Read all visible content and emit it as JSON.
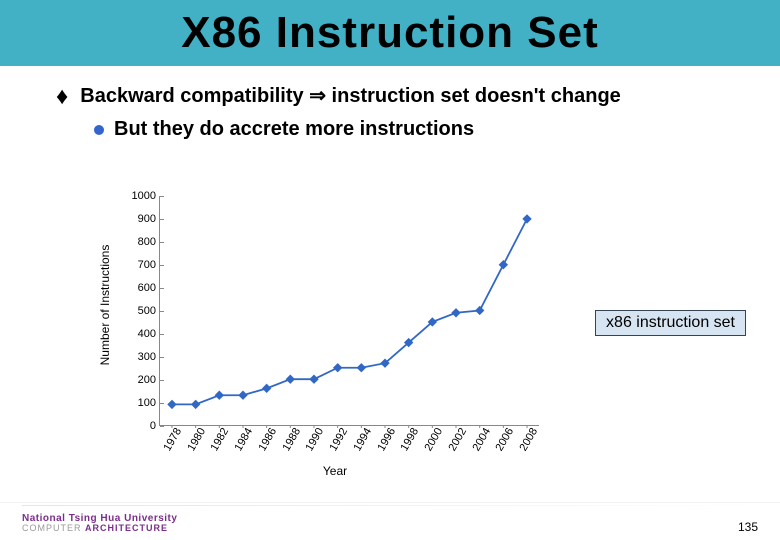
{
  "title": "X86 Instruction Set",
  "bullets": {
    "l1_a": "Backward compatibility ",
    "l1_implies": "⇒",
    "l1_b": " instruction set doesn't change",
    "l2": "But they do accrete more instructions"
  },
  "callout": "x86 instruction set",
  "footer": {
    "university": "National Tsing Hua University",
    "dept_a": "COMPUTER ",
    "dept_b": "ARCHITECTURE",
    "page": "135"
  },
  "chart_data": {
    "type": "line",
    "title": "",
    "xlabel": "Year",
    "ylabel": "Number of Instructions",
    "ylim": [
      0,
      1000
    ],
    "yticks": [
      0,
      100,
      200,
      300,
      400,
      500,
      600,
      700,
      800,
      900,
      1000
    ],
    "categories": [
      "1978",
      "1980",
      "1982",
      "1984",
      "1986",
      "1988",
      "1990",
      "1992",
      "1994",
      "1996",
      "1998",
      "2000",
      "2002",
      "2004",
      "2006",
      "2008"
    ],
    "values": [
      90,
      90,
      130,
      130,
      160,
      200,
      200,
      250,
      250,
      270,
      360,
      450,
      490,
      500,
      700,
      900
    ]
  }
}
